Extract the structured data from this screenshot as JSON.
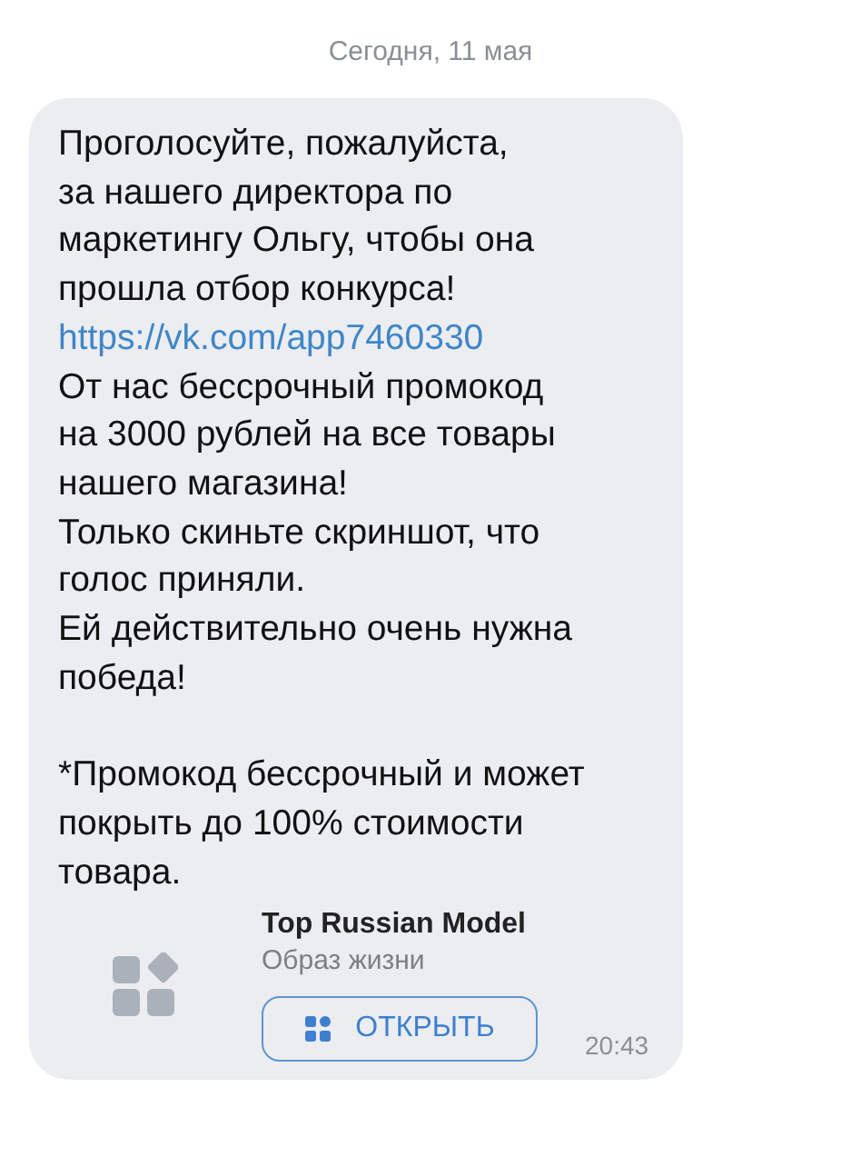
{
  "date_divider": "Сегодня, 11 мая",
  "message": {
    "blocks": [
      {
        "kind": "text",
        "text": "Проголосуйте, пожалуйста,\nза нашего директора по\nмаркетингу Ольгу, чтобы она\nпрошла отбор конкурса!"
      },
      {
        "kind": "link",
        "text": "https://vk.com/app7460330"
      },
      {
        "kind": "text",
        "text": "От нас бессрочный промокод\nна 3000 рублей на все товары\nнашего магазина!"
      },
      {
        "kind": "text",
        "text": "Только скиньте скриншот, что\nголос приняли."
      },
      {
        "kind": "text",
        "text": "Ей действительно очень нужна\nпобеда!"
      },
      {
        "kind": "gap"
      },
      {
        "kind": "text",
        "text": "*Промокод бессрочный и может\nпокрыть до 100% стоимости\nтовара."
      }
    ],
    "attachment": {
      "title": "Top Russian Model",
      "subtitle": "Образ жизни",
      "button": "ОТКРЫТЬ"
    },
    "time": "20:43"
  }
}
